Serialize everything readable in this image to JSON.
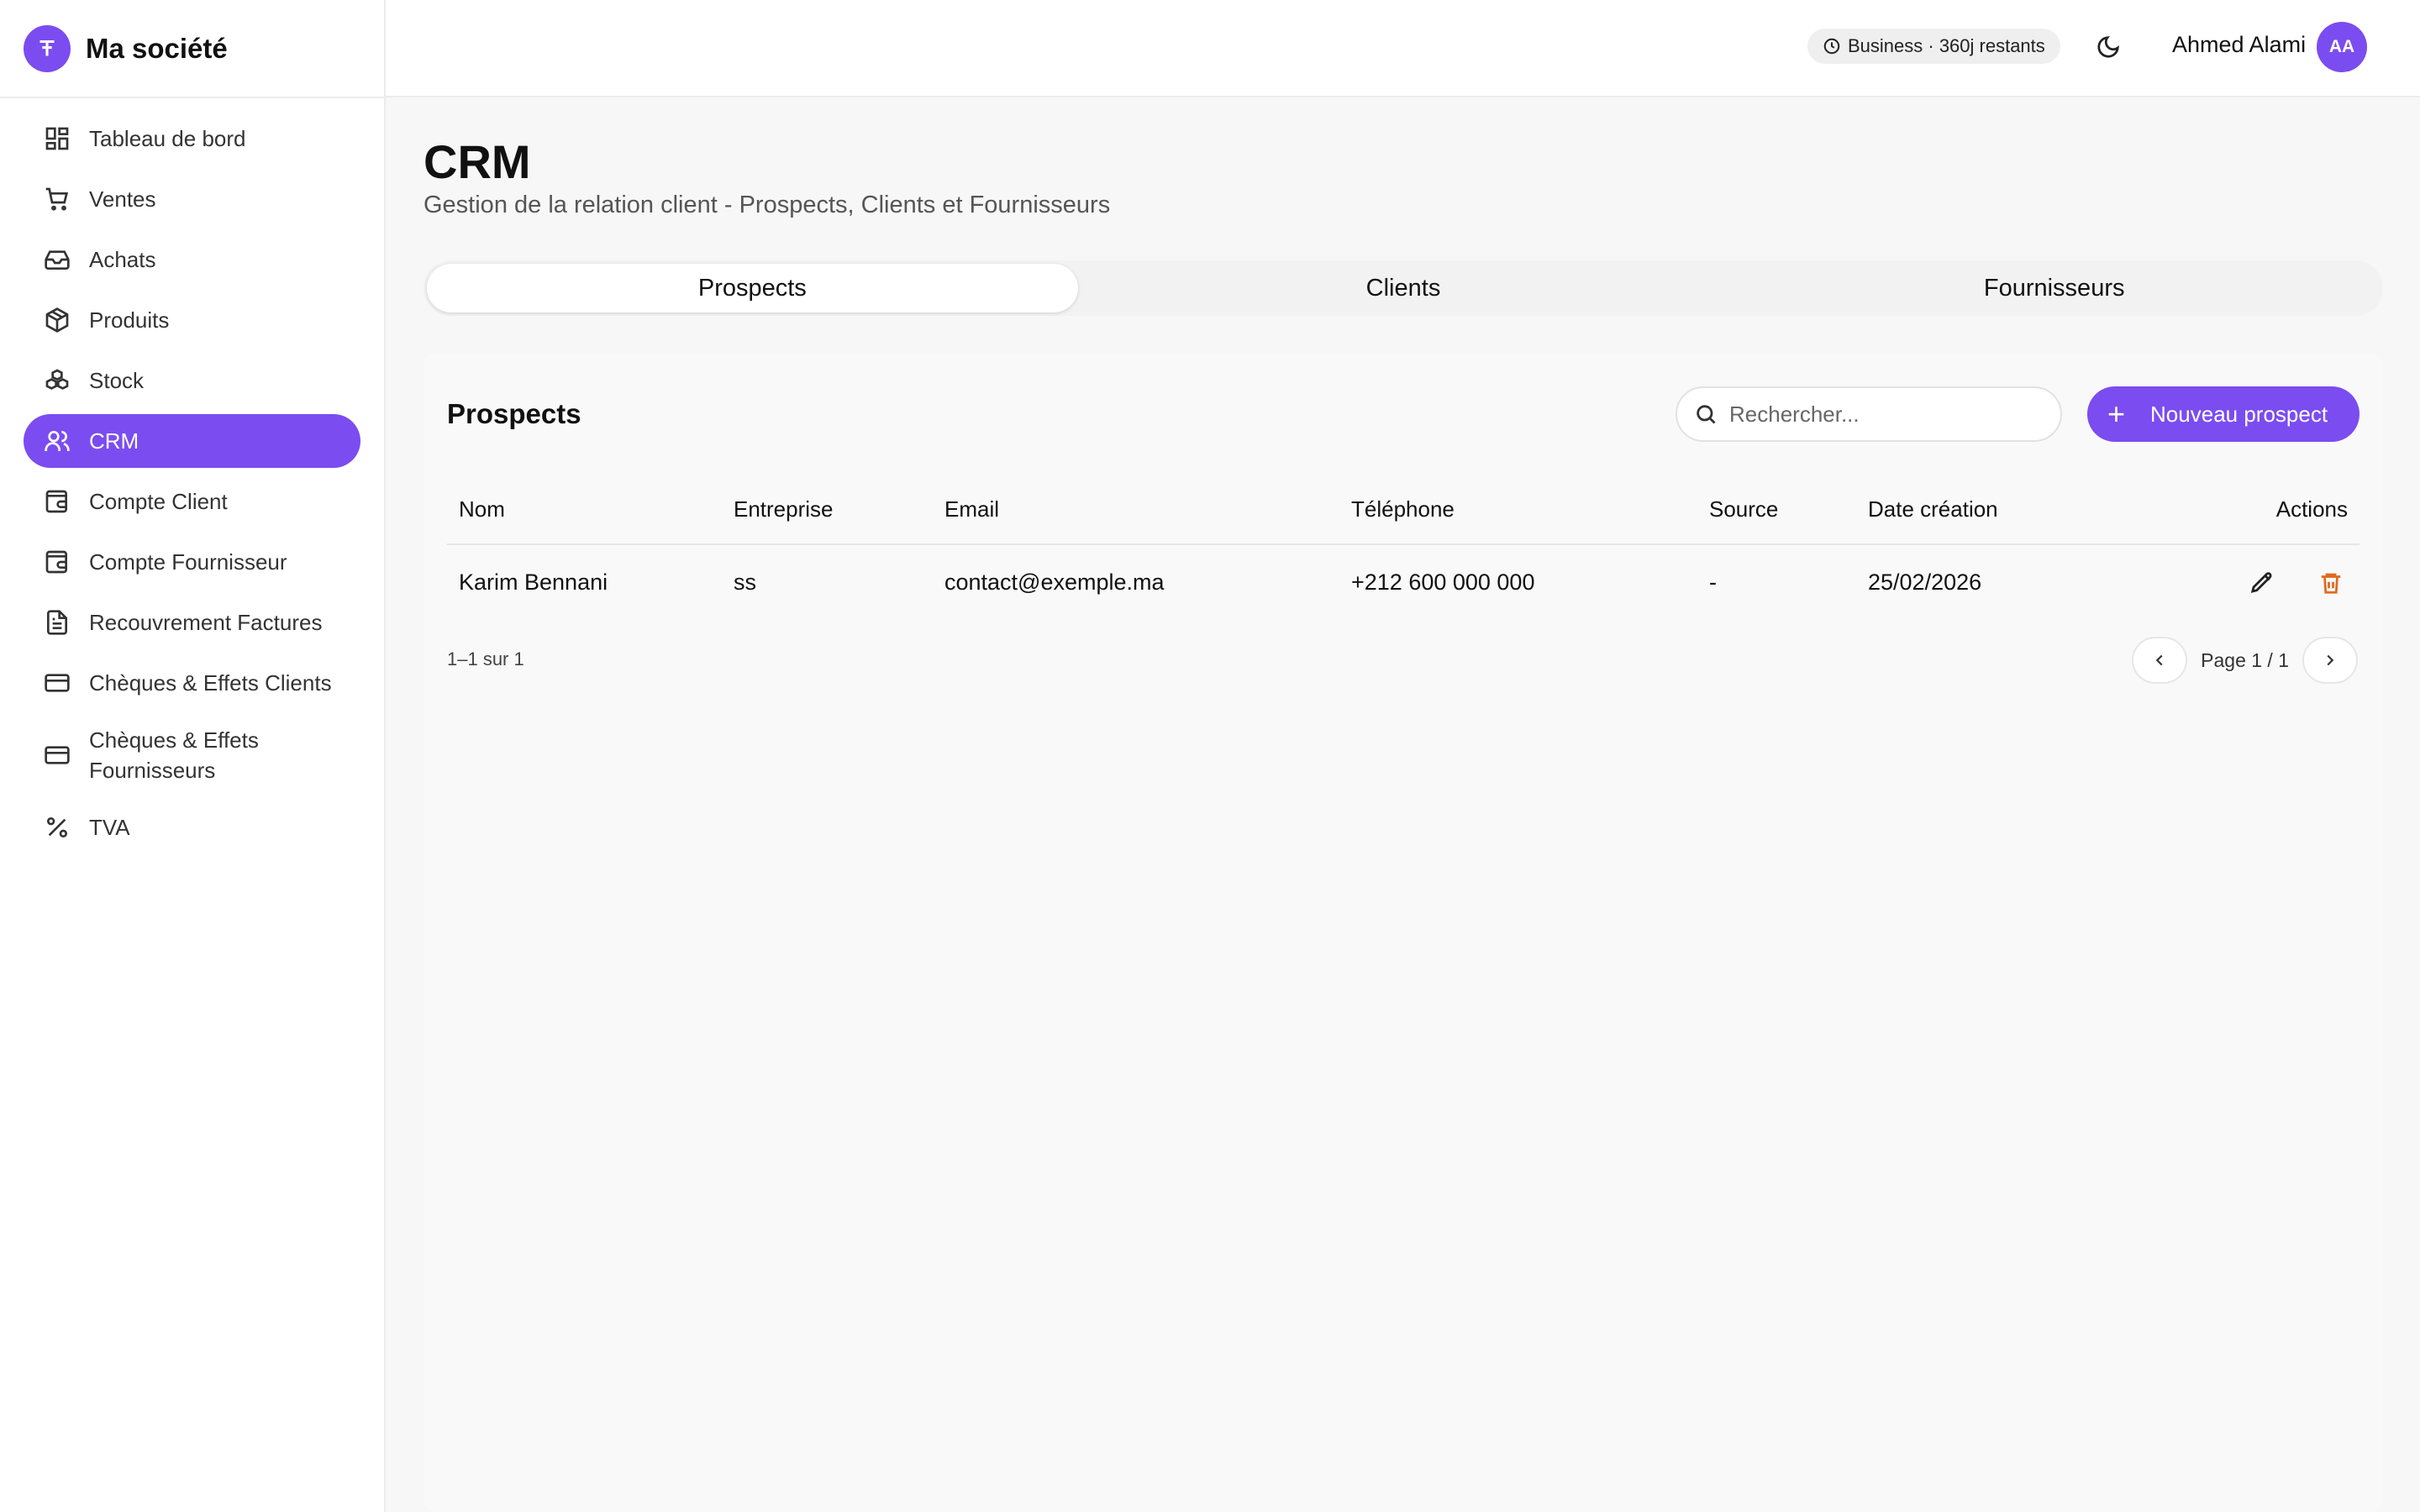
{
  "brand": {
    "name": "Ma société"
  },
  "sidebar": {
    "items": [
      {
        "label": "Tableau de bord",
        "icon": "dashboard-icon"
      },
      {
        "label": "Ventes",
        "icon": "cart-icon"
      },
      {
        "label": "Achats",
        "icon": "inbox-icon"
      },
      {
        "label": "Produits",
        "icon": "package-icon"
      },
      {
        "label": "Stock",
        "icon": "boxes-icon"
      },
      {
        "label": "CRM",
        "icon": "users-icon",
        "active": true
      },
      {
        "label": "Compte Client",
        "icon": "wallet-icon"
      },
      {
        "label": "Compte Fournisseur",
        "icon": "wallet-icon"
      },
      {
        "label": "Recouvrement Factures",
        "icon": "file-text-icon"
      },
      {
        "label": "Chèques & Effets Clients",
        "icon": "credit-card-icon"
      },
      {
        "label": "Chèques & Effets Fournisseurs",
        "icon": "credit-card-icon"
      },
      {
        "label": "TVA",
        "icon": "percent-icon"
      }
    ]
  },
  "header": {
    "plan_badge": "Business · 360j restants",
    "user_name": "Ahmed Alami",
    "avatar_initials": "AA"
  },
  "page": {
    "title": "CRM",
    "subtitle": "Gestion de la relation client - Prospects, Clients et Fournisseurs"
  },
  "tabs": [
    {
      "label": "Prospects",
      "active": true
    },
    {
      "label": "Clients"
    },
    {
      "label": "Fournisseurs"
    }
  ],
  "card": {
    "title": "Prospects",
    "search_placeholder": "Rechercher...",
    "new_button": "Nouveau prospect"
  },
  "table": {
    "columns": [
      "Nom",
      "Entreprise",
      "Email",
      "Téléphone",
      "Source",
      "Date création",
      "Actions"
    ],
    "rows": [
      [
        "Karim Bennani",
        "ss",
        "contact@exemple.ma",
        "+212 600 000 000",
        "-",
        "25/02/2026"
      ]
    ]
  },
  "pagination": {
    "count": "1–1 sur 1",
    "page_label": "Page 1 / 1"
  },
  "colors": {
    "accent": "#7b4cf0",
    "delete": "#e06a1f"
  }
}
